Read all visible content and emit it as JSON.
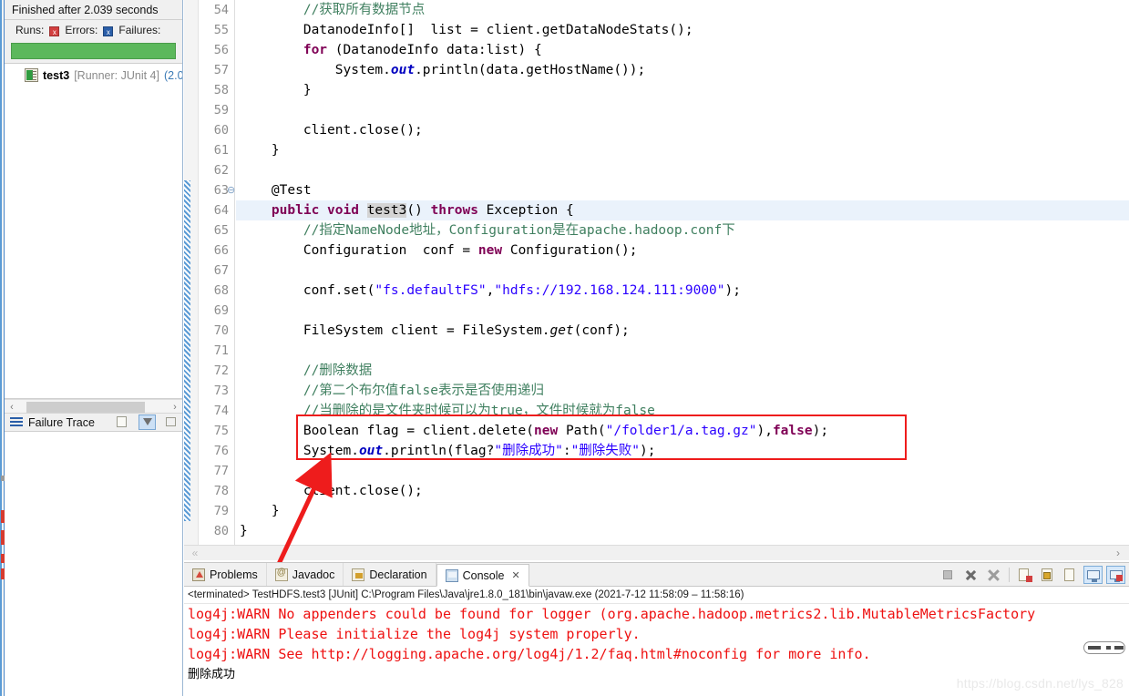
{
  "junit": {
    "header": "Finished after 2.039 seconds",
    "counts": {
      "runs_label": "Runs:",
      "errors_label": "Errors:",
      "failures_label": "Failures:"
    },
    "progress_color": "#5cb85c",
    "tree": [
      {
        "name": "test3",
        "runner": "[Runner: JUnit 4]",
        "time": "(2.0"
      }
    ],
    "failure_trace_label": "Failure Trace",
    "toolbar": [
      "show-stack-trace-icon",
      "filter-stack-trace-icon",
      "compare-result-icon"
    ]
  },
  "editor": {
    "lines": [
      {
        "n": "54",
        "fold": "",
        "changed": false,
        "hl": false,
        "html": "        <span class='cmt'>//获取所有数据节点</span>"
      },
      {
        "n": "55",
        "fold": "",
        "changed": false,
        "hl": false,
        "html": "        DatanodeInfo[]  list = client.getDataNodeStats();"
      },
      {
        "n": "56",
        "fold": "",
        "changed": false,
        "hl": false,
        "html": "        <span class='kw'>for</span> (DatanodeInfo data:list) {"
      },
      {
        "n": "57",
        "fold": "",
        "changed": false,
        "hl": false,
        "html": "            System.<span class='fld'>out</span>.println(data.getHostName());"
      },
      {
        "n": "58",
        "fold": "",
        "changed": false,
        "hl": false,
        "html": "        }"
      },
      {
        "n": "59",
        "fold": "",
        "changed": false,
        "hl": false,
        "html": ""
      },
      {
        "n": "60",
        "fold": "",
        "changed": false,
        "hl": false,
        "html": "        client.close();"
      },
      {
        "n": "61",
        "fold": "",
        "changed": false,
        "hl": false,
        "html": "    }"
      },
      {
        "n": "62",
        "fold": "",
        "changed": false,
        "hl": false,
        "html": ""
      },
      {
        "n": "63",
        "fold": "⊖",
        "changed": true,
        "hl": false,
        "html": "    @Test"
      },
      {
        "n": "64",
        "fold": "",
        "changed": true,
        "hl": true,
        "html": "    <span class='kw'>public</span> <span class='kw'>void</span> <span class='sel-tok'>test3</span>() <span class='kw'>throws</span> Exception {"
      },
      {
        "n": "65",
        "fold": "",
        "changed": true,
        "hl": false,
        "html": "        <span class='cmt'>//指定NameNode地址，Configuration是在apache.hadoop.conf下</span>"
      },
      {
        "n": "66",
        "fold": "",
        "changed": true,
        "hl": false,
        "html": "        Configuration  conf = <span class='kw'>new</span> Configuration();"
      },
      {
        "n": "67",
        "fold": "",
        "changed": true,
        "hl": false,
        "html": ""
      },
      {
        "n": "68",
        "fold": "",
        "changed": true,
        "hl": false,
        "html": "        conf.set(<span class='str'>\"fs.defaultFS\"</span>,<span class='str'>\"hdfs://192.168.124.111:9000\"</span>);"
      },
      {
        "n": "69",
        "fold": "",
        "changed": true,
        "hl": false,
        "html": ""
      },
      {
        "n": "70",
        "fold": "",
        "changed": true,
        "hl": false,
        "html": "        FileSystem client = FileSystem.<span class='stc'>get</span>(conf);"
      },
      {
        "n": "71",
        "fold": "",
        "changed": true,
        "hl": false,
        "html": ""
      },
      {
        "n": "72",
        "fold": "",
        "changed": true,
        "hl": false,
        "html": "        <span class='cmt'>//删除数据</span>"
      },
      {
        "n": "73",
        "fold": "",
        "changed": true,
        "hl": false,
        "html": "        <span class='cmt'>//第二个布尔值false表示是否使用递归</span>"
      },
      {
        "n": "74",
        "fold": "",
        "changed": true,
        "hl": false,
        "html": "        <span class='cmt'>//当删除的是文件夹时候可以为true，文件时候就为false</span>"
      },
      {
        "n": "75",
        "fold": "",
        "changed": true,
        "hl": false,
        "html": "        Boolean flag = client.delete(<span class='kw'>new</span> Path(<span class='str'>\"/folder1/a.tag.gz\"</span>),<span class='kw'>false</span>);"
      },
      {
        "n": "76",
        "fold": "",
        "changed": true,
        "hl": false,
        "html": "        System.<span class='fld'>out</span>.println(flag?<span class='str'>\"删除成功\"</span>:<span class='str'>\"删除失败\"</span>);"
      },
      {
        "n": "77",
        "fold": "",
        "changed": true,
        "hl": false,
        "html": ""
      },
      {
        "n": "78",
        "fold": "",
        "changed": true,
        "hl": false,
        "html": "        client.close();"
      },
      {
        "n": "79",
        "fold": "",
        "changed": true,
        "hl": false,
        "html": "    }"
      },
      {
        "n": "80",
        "fold": "",
        "changed": false,
        "hl": false,
        "html": "}"
      }
    ],
    "hscroll_left": "«",
    "hscroll_right": "›"
  },
  "annotation": {
    "box_color": "#ee1c1c",
    "arrow_color": "#ee1c1c"
  },
  "console": {
    "tabs": [
      {
        "label": "Problems",
        "icon": "problems-icon",
        "active": false
      },
      {
        "label": "Javadoc",
        "icon": "javadoc-icon",
        "active": false
      },
      {
        "label": "Declaration",
        "icon": "declaration-icon",
        "active": false
      },
      {
        "label": "Console",
        "icon": "console-icon",
        "active": true,
        "close": "✕"
      }
    ],
    "toolbar": [
      "terminate-icon",
      "remove-launch-icon",
      "remove-all-terminated-icon",
      "clear-console-icon",
      "scroll-lock-icon",
      "word-wrap-icon",
      "display-selected-console-icon",
      "open-console-icon"
    ],
    "terminated_line": "<terminated> TestHDFS.test3 [JUnit] C:\\Program Files\\Java\\jre1.8.0_181\\bin\\javaw.exe  (2021-7-12 11:58:09 – 11:58:16)",
    "output": [
      {
        "text": "log4j:WARN No appenders could be found for logger (org.apache.hadoop.metrics2.lib.MutableMetricsFactory",
        "stream": "err"
      },
      {
        "text": "log4j:WARN Please initialize the log4j system properly.",
        "stream": "err"
      },
      {
        "text": "log4j:WARN See http://logging.apache.org/log4j/1.2/faq.html#noconfig for more info.",
        "stream": "err"
      },
      {
        "text": "删除成功",
        "stream": "out"
      }
    ]
  },
  "watermark": "https://blog.csdn.net/lys_828"
}
